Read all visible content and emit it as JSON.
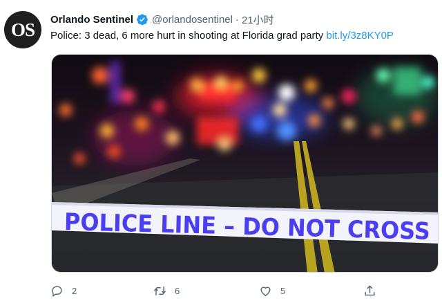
{
  "account": {
    "avatar_text": "OS",
    "display_name": "Orlando Sentinel",
    "handle": "@orlandosentinel",
    "separator": "·",
    "time": "21小时"
  },
  "tweet": {
    "text": "Police: 3 dead, 6 more hurt in shooting at Florida grad party ",
    "link": "bit.ly/3z8KY0P"
  },
  "media": {
    "tape_text": "POLICE LINE – DO NOT CROSS",
    "tape_color": "#4b3df0"
  },
  "actions": {
    "reply_count": "2",
    "retweet_count": "6",
    "like_count": "5"
  },
  "colors": {
    "link": "#1d9bf0",
    "verified": "#1d9bf0",
    "secondary_text": "#536471"
  }
}
